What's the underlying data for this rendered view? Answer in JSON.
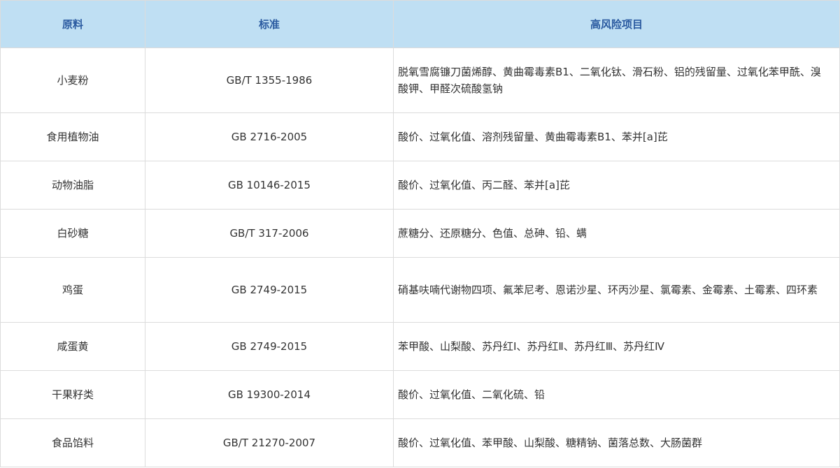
{
  "table": {
    "headers": [
      "原料",
      "标准",
      "高风险项目"
    ],
    "rows": [
      {
        "material": "小麦粉",
        "standard": "GB/T 1355-1986",
        "risks": "脱氧雪腐镰刀菌烯醇、黄曲霉毒素B1、二氧化钛、滑石粉、铝的残留量、过氧化苯甲酰、溴酸钾、甲醛次硫酸氢钠"
      },
      {
        "material": "食用植物油",
        "standard": "GB 2716-2005",
        "risks": "酸价、过氧化值、溶剂残留量、黄曲霉毒素B1、苯并[a]芘"
      },
      {
        "material": "动物油脂",
        "standard": "GB 10146-2015",
        "risks": "酸价、过氧化值、丙二醛、苯并[a]芘"
      },
      {
        "material": "白砂糖",
        "standard": "GB/T 317-2006",
        "risks": "蔗糖分、还原糖分、色值、总砷、铅、螨"
      },
      {
        "material": "鸡蛋",
        "standard": "GB 2749-2015",
        "risks": "硝基呋喃代谢物四项、氟苯尼考、恩诺沙星、环丙沙星、氯霉素、金霉素、土霉素、四环素"
      },
      {
        "material": "咸蛋黄",
        "standard": "GB 2749-2015",
        "risks": "苯甲酸、山梨酸、苏丹红Ⅰ、苏丹红Ⅱ、苏丹红Ⅲ、苏丹红Ⅳ"
      },
      {
        "material": "干果籽类",
        "standard": "GB 19300-2014",
        "risks": "酸价、过氧化值、二氧化硫、铅"
      },
      {
        "material": "食品馅料",
        "standard": "GB/T 21270-2007",
        "risks": "酸价、过氧化值、苯甲酸、山梨酸、糖精钠、菌落总数、大肠菌群"
      }
    ]
  }
}
